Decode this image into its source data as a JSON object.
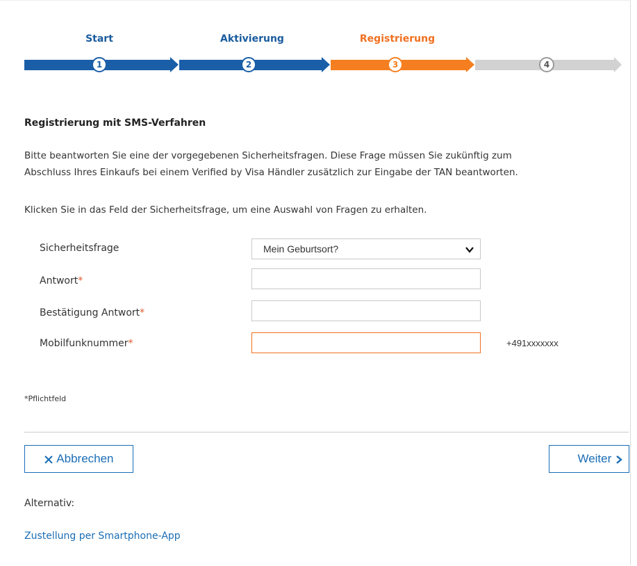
{
  "steps": [
    {
      "label": "Start",
      "number": "1",
      "state": "done"
    },
    {
      "label": "Aktivierung",
      "number": "2",
      "state": "done"
    },
    {
      "label": "Registrierung",
      "number": "3",
      "state": "active"
    },
    {
      "label": "",
      "number": "4",
      "state": "future"
    }
  ],
  "colors": {
    "done": "#1a5ea8",
    "active": "#f57f20",
    "future": "#d2d2d2"
  },
  "heading": "Registrierung mit SMS-Verfahren",
  "intro_line1": "Bitte beantworten Sie eine der vorgegebenen Sicherheitsfragen. Diese Frage müssen Sie zukünftig zum",
  "intro_line2": "Abschluss Ihres Einkaufs bei einem Verified by Visa Händler zusätzlich zur Eingabe der TAN beantworten.",
  "instruction": "Klicken Sie in das Feld der Sicherheitsfrage, um eine Auswahl von Fragen zu erhalten.",
  "form": {
    "question_label": "Sicherheitsfrage",
    "question_value": "Mein Geburtsort?",
    "answer_label": "Antwort",
    "answer_value": "",
    "confirm_label": "Bestätigung Antwort",
    "confirm_value": "",
    "mobile_label": "Mobilfunknummer",
    "mobile_value": "",
    "required_mark": "*",
    "mobile_hint": "+491xxxxxxx"
  },
  "footnote": "*Pflichtfeld",
  "buttons": {
    "cancel": "Abbrechen",
    "next": "Weiter"
  },
  "alt_label": "Alternativ:",
  "alt_link": "Zustellung per Smartphone-App"
}
